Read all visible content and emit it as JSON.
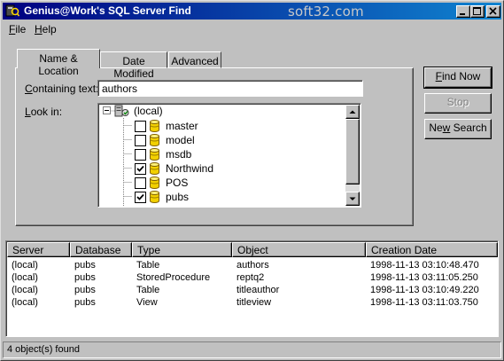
{
  "window": {
    "title": "Genius@Work's SQL Server Find",
    "watermark": "soft32.com"
  },
  "menu": {
    "items": [
      {
        "label": "File",
        "accel": "F",
        "rest": "ile"
      },
      {
        "label": "Help",
        "accel": "H",
        "rest": "elp"
      }
    ]
  },
  "tabs": [
    {
      "label": "Name & Location",
      "active": true
    },
    {
      "label": "Date Modified",
      "active": false
    },
    {
      "label": "Advanced",
      "active": false
    }
  ],
  "search": {
    "containing_label": "Containing text:",
    "containing_accel": "C",
    "containing_rest": "ontaining text:",
    "containing_value": "authors",
    "lookin_label": "Look in:",
    "lookin_accel": "L",
    "lookin_rest": "ook in:"
  },
  "tree": {
    "root": "(local)",
    "databases": [
      {
        "name": "master",
        "checked": false
      },
      {
        "name": "model",
        "checked": false
      },
      {
        "name": "msdb",
        "checked": false
      },
      {
        "name": "Northwind",
        "checked": true
      },
      {
        "name": "POS",
        "checked": false
      },
      {
        "name": "pubs",
        "checked": true
      }
    ]
  },
  "buttons": {
    "find_now": "Find Now",
    "find_now_accel": "F",
    "find_now_rest": "ind Now",
    "stop": "Stop",
    "new_search": "New Search",
    "new_search_accel": "w",
    "new_search_pre": "Ne",
    "new_search_rest": " Search"
  },
  "results": {
    "columns": [
      "Server",
      "Database",
      "Type",
      "Object",
      "Creation Date"
    ],
    "rows": [
      [
        "(local)",
        "pubs",
        "Table",
        "authors",
        "1998-11-13 03:10:48.470"
      ],
      [
        "(local)",
        "pubs",
        "StoredProcedure",
        "reptq2",
        "1998-11-13 03:11:05.250"
      ],
      [
        "(local)",
        "pubs",
        "Table",
        "titleauthor",
        "1998-11-13 03:10:49.220"
      ],
      [
        "(local)",
        "pubs",
        "View",
        "titleview",
        "1998-11-13 03:11:03.750"
      ]
    ]
  },
  "status": {
    "text": "4 object(s) found"
  }
}
